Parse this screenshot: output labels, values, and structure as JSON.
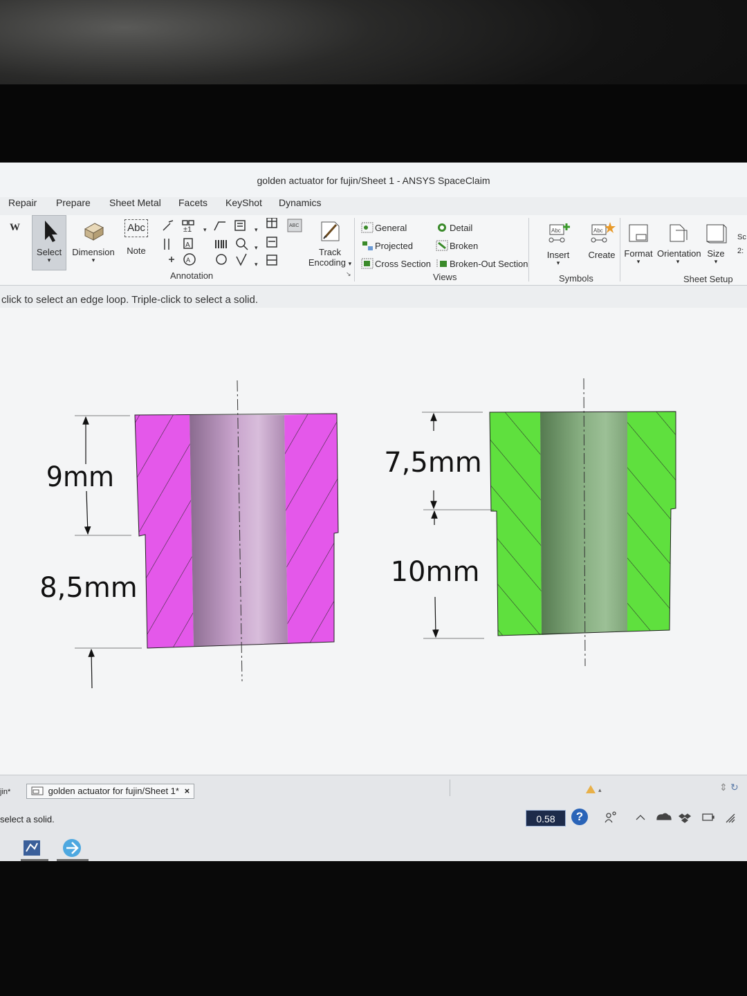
{
  "window": {
    "title": "golden actuator for fujin/Sheet 1 - ANSYS SpaceClaim"
  },
  "menu": {
    "repair": "Repair",
    "prepare": "Prepare",
    "sheet_metal": "Sheet Metal",
    "facets": "Facets",
    "keyshot": "KeyShot",
    "dynamics": "Dynamics"
  },
  "ribbon": {
    "w_label": "W",
    "select": "Select",
    "dimension": "Dimension",
    "note": "Note",
    "note_icon_text": "Abc",
    "annotation_group": "Annotation",
    "track": "Track",
    "encoding": "Encoding",
    "views": {
      "general": "General",
      "detail": "Detail",
      "projected": "Projected",
      "broken": "Broken",
      "cross_section": "Cross Section",
      "broken_out": "Broken-Out Section",
      "group": "Views"
    },
    "symbols": {
      "insert": "Insert",
      "create": "Create",
      "group": "Symbols"
    },
    "sheet_setup": {
      "format": "Format",
      "orientation": "Orientation",
      "size": "Size",
      "group": "Sheet Setup"
    },
    "sc_cut": "Sc",
    "sc_value": "2:"
  },
  "hint": "click to select an edge loop. Triple-click to select a solid.",
  "drawing": {
    "left_part": {
      "top_dim": "9mm",
      "bottom_dim": "8,5mm",
      "color": "#e458ea",
      "bore_color": "#b98fc0"
    },
    "right_part": {
      "top_dim": "7,5mm",
      "bottom_dim": "10mm",
      "color": "#5fe03e",
      "bore_color": "#7fa57a"
    }
  },
  "bottom": {
    "left_cut_tab": "jin*",
    "doc_tab": "golden actuator for fujin/Sheet 1*",
    "tab_close": "×",
    "status": "select a solid.",
    "zoom": "0.58",
    "help": "?"
  }
}
